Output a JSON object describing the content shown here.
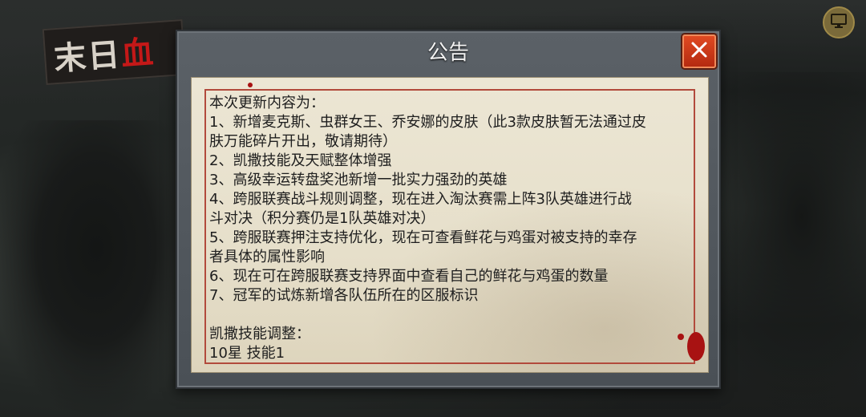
{
  "game": {
    "logo_prefix": "末日",
    "logo_suffix": "血"
  },
  "dialog": {
    "title": "公告",
    "lines": [
      "本次更新内容为：",
      "1、新增麦克斯、虫群女王、乔安娜的皮肤（此3款皮肤暂无法通过皮",
      "肤万能碎片开出，敬请期待）",
      "2、凯撒技能及天赋整体增强",
      "3、高级幸运转盘奖池新增一批实力强劲的英雄",
      "4、跨服联赛战斗规则调整，现在进入淘汰赛需上阵3队英雄进行战",
      "斗对决（积分赛仍是1队英雄对决）",
      "5、跨服联赛押注支持优化，现在可查看鲜花与鸡蛋对被支持的幸存",
      "者具体的属性影响",
      "6、现在可在跨服联赛支持界面中查看自己的鲜花与鸡蛋的数量",
      "7、冠军的试炼新增各队伍所在的区服标识",
      "",
      "凯撒技能调整：",
      "10星 技能1"
    ]
  },
  "icons": {
    "close": "close-icon",
    "monitor": "monitor-icon"
  },
  "colors": {
    "accent_red": "#c41818",
    "close_button": "#d03a18",
    "paper": "#e8e1cc",
    "panel": "#555b61",
    "monitor_button": "#7a6a3a"
  }
}
